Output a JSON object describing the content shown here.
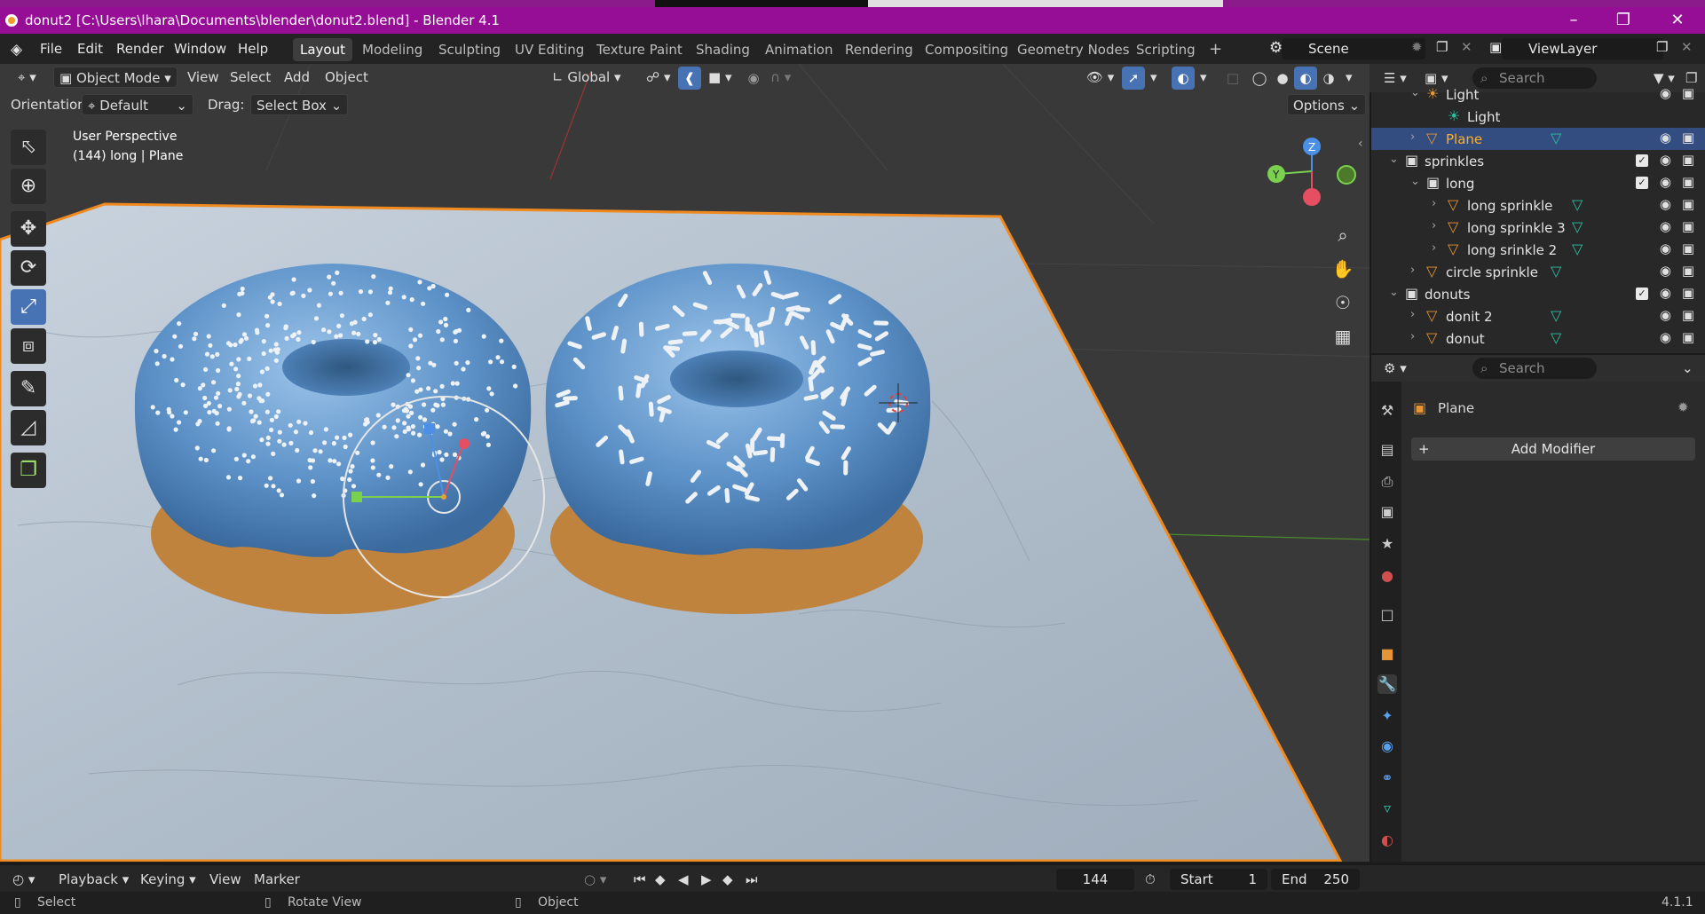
{
  "window": {
    "title": "donut2 [C:\\Users\\lhara\\Documents\\blender\\donut2.blend] - Blender 4.1",
    "minimize_icon": "minimize-icon",
    "maximize_icon": "restore-icon",
    "close_icon": "close-icon",
    "bar_color": "#960d96"
  },
  "menu": {
    "items": [
      "File",
      "Edit",
      "Render",
      "Window",
      "Help"
    ],
    "workspaces": [
      "Layout",
      "Modeling",
      "Sculpting",
      "UV Editing",
      "Texture Paint",
      "Shading",
      "Animation",
      "Rendering",
      "Compositing",
      "Geometry Nodes",
      "Scripting"
    ],
    "active_workspace": "Layout",
    "add_workspace": "+",
    "scene": "Scene",
    "view_layer": "ViewLayer"
  },
  "viewport_header": {
    "mode": "Object Mode",
    "menus": [
      "View",
      "Select",
      "Add",
      "Object"
    ],
    "orientation_transform": "Global",
    "options": "Options"
  },
  "tool_settings": {
    "orientation_label": "Orientation:",
    "orientation_value": "Default",
    "drag_label": "Drag:",
    "drag_value": "Select Box"
  },
  "viewport": {
    "perspective": "User Perspective",
    "object_info": "(144) long | Plane",
    "gizmo": {
      "x": "",
      "y": "Y",
      "z": "Z"
    }
  },
  "outliner": {
    "search_placeholder": "Search",
    "rows": [
      {
        "label": "Light",
        "indent": 2,
        "icon": "light-object-icon",
        "partial": true
      },
      {
        "label": "Light",
        "indent": 3,
        "icon": "light-data-icon"
      },
      {
        "label": "Plane",
        "indent": 2,
        "icon": "mesh-object-icon",
        "selected": true
      },
      {
        "label": "sprinkles",
        "indent": 1,
        "icon": "collection-icon"
      },
      {
        "label": "long",
        "indent": 2,
        "icon": "collection-icon"
      },
      {
        "label": "long sprinkle",
        "indent": 3,
        "icon": "mesh-object-icon"
      },
      {
        "label": "long sprinkle 3",
        "indent": 3,
        "icon": "mesh-object-icon"
      },
      {
        "label": "long srinkle 2",
        "indent": 3,
        "icon": "mesh-object-icon"
      },
      {
        "label": "circle sprinkle",
        "indent": 2,
        "icon": "mesh-object-icon"
      },
      {
        "label": "donuts",
        "indent": 1,
        "icon": "collection-icon"
      },
      {
        "label": "donit 2",
        "indent": 2,
        "icon": "mesh-object-icon"
      },
      {
        "label": "donut",
        "indent": 2,
        "icon": "mesh-object-icon"
      }
    ]
  },
  "properties": {
    "search_placeholder": "Search",
    "object_name": "Plane",
    "add_modifier": "Add Modifier"
  },
  "timeline": {
    "menus": [
      "Playback",
      "Keying",
      "View",
      "Marker"
    ],
    "current_frame": "144",
    "start_label": "Start",
    "start_value": "1",
    "end_label": "End",
    "end_value": "250"
  },
  "statusbar": {
    "select": "Select",
    "rotate": "Rotate View",
    "object": "Object",
    "version": "4.1.1"
  }
}
